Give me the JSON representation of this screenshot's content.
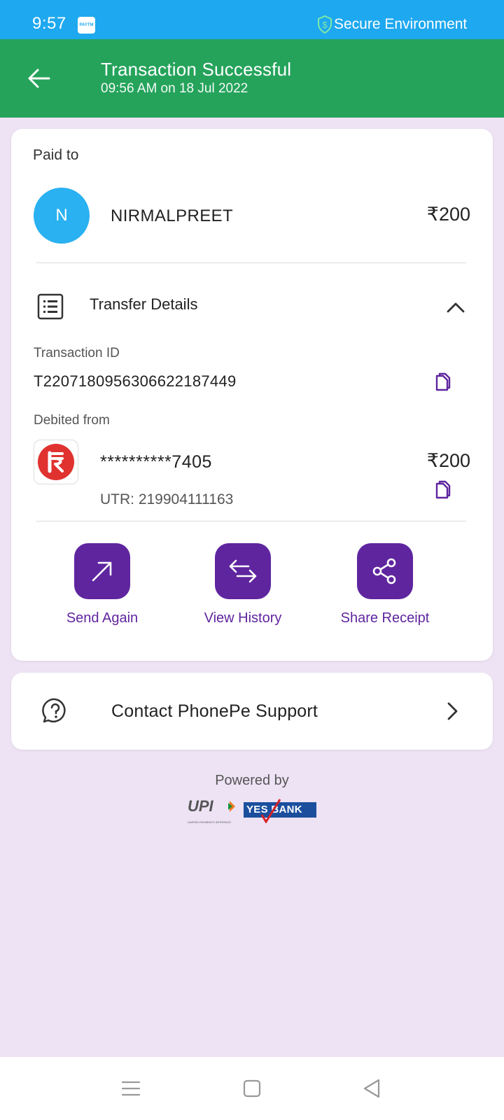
{
  "status_bar": {
    "time": "9:57",
    "app_badge": "PAYTM",
    "secure_label": "Secure Environment"
  },
  "header": {
    "title": "Transaction Successful",
    "subtitle": "09:56 AM on 18 Jul 2022"
  },
  "payment": {
    "paid_to_label": "Paid to",
    "avatar_initial": "N",
    "payee_name": "NIRMALPREET",
    "amount": "₹200"
  },
  "transfer_details": {
    "title": "Transfer Details",
    "transaction_id_label": "Transaction ID",
    "transaction_id": "T2207180956306622187449",
    "debited_from_label": "Debited from",
    "account_masked": "**********7405",
    "debited_amount": "₹200",
    "utr": "UTR: 219904111163"
  },
  "actions": [
    {
      "label": "Send Again"
    },
    {
      "label": "View History"
    },
    {
      "label": "Share Receipt"
    }
  ],
  "support": {
    "label": "Contact PhonePe Support"
  },
  "footer": {
    "powered_by": "Powered by",
    "upi_text": "UPI",
    "upi_subtext": "UNIFIED PAYMENTS INTERFACE",
    "bank_text": "YES BANK"
  },
  "colors": {
    "status_bar": "#1ea8ef",
    "header_green": "#25a35b",
    "accent_purple": "#5f259f",
    "avatar_blue": "#29b1f1",
    "page_bg": "#ede3f5"
  }
}
